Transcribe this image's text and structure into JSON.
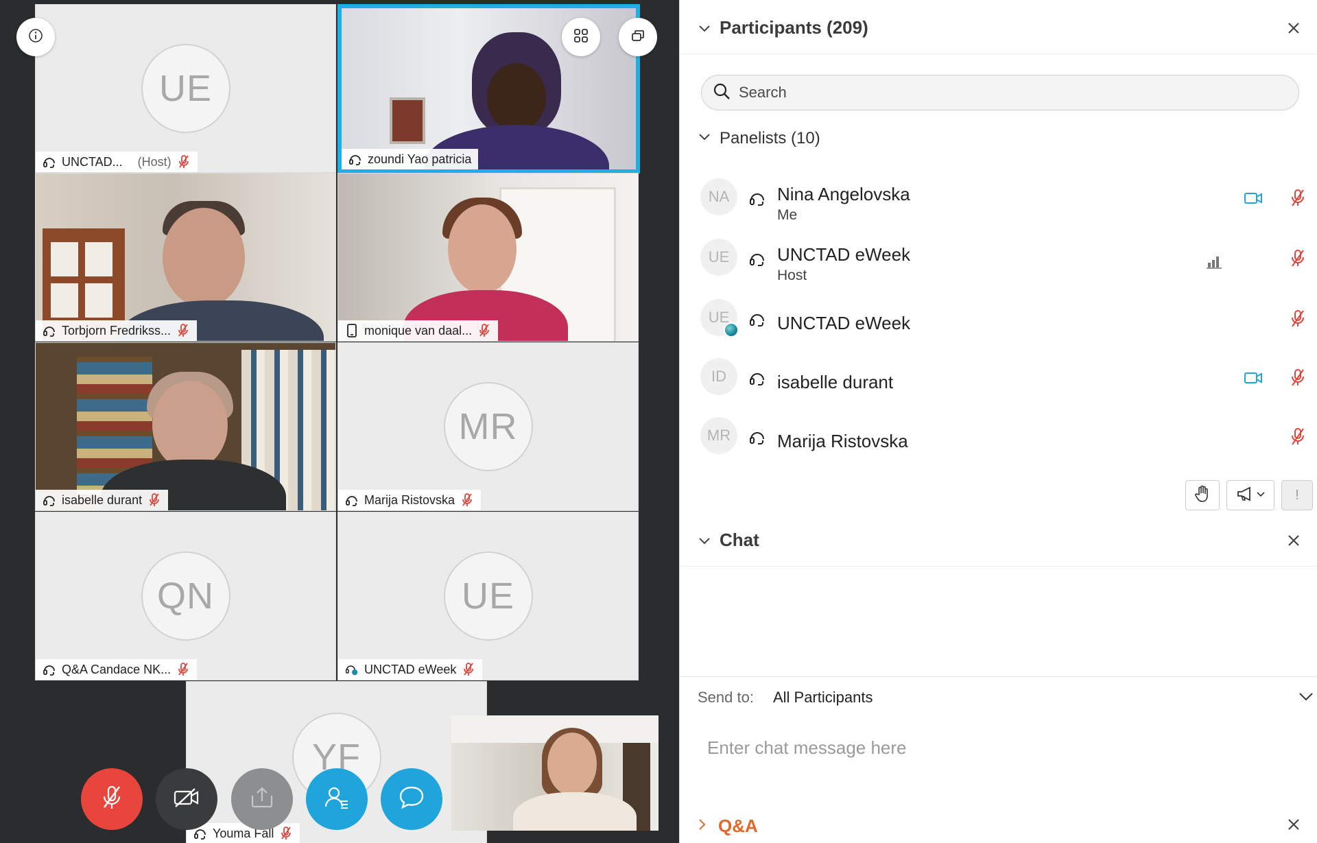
{
  "video_grid": {
    "tiles": [
      {
        "name": "UNCTAD...",
        "role": "(Host)",
        "initials": "UE"
      },
      {
        "name": "zoundi Yao patricia",
        "initials": ""
      },
      {
        "name": "Torbjorn Fredrikss...",
        "initials": ""
      },
      {
        "name": "monique van daal...",
        "initials": ""
      },
      {
        "name": "isabelle durant",
        "initials": ""
      },
      {
        "name": "Marija Ristovska",
        "initials": "MR"
      },
      {
        "name": "Q&A Candace NK...",
        "initials": "QN"
      },
      {
        "name": "UNCTAD eWeek",
        "initials": "UE"
      },
      {
        "name": "Youma Fall",
        "initials": "YF"
      }
    ]
  },
  "controls": {
    "mute": "mic-muted-icon",
    "video": "video-off-icon",
    "share": "share-icon",
    "participants": "participants-icon",
    "chat": "chat-icon"
  },
  "participants_panel": {
    "title": "Participants (209)",
    "search_placeholder": "Search",
    "panelists_label": "Panelists (10)",
    "panelists": [
      {
        "initials": "NA",
        "name": "Nina Angelovska",
        "sub": "Me"
      },
      {
        "initials": "UE",
        "name": "UNCTAD eWeek",
        "sub": "Host"
      },
      {
        "initials": "UE",
        "name": "UNCTAD eWeek",
        "sub": ""
      },
      {
        "initials": "ID",
        "name": "isabelle durant",
        "sub": ""
      },
      {
        "initials": "MR",
        "name": "Marija Ristovska",
        "sub": ""
      }
    ],
    "tool_exclaim": "!"
  },
  "chat_panel": {
    "title": "Chat",
    "send_to_label": "Send to:",
    "send_to_value": "All Participants",
    "input_placeholder": "Enter chat message here"
  },
  "qa_panel": {
    "title": "Q&A"
  },
  "colors": {
    "accent": "#1fb0e3",
    "mute_red": "#e8453c",
    "chat_blue": "#1fa5dc",
    "qa_orange": "#e06a2a",
    "muted_mic": "#e0443a"
  }
}
